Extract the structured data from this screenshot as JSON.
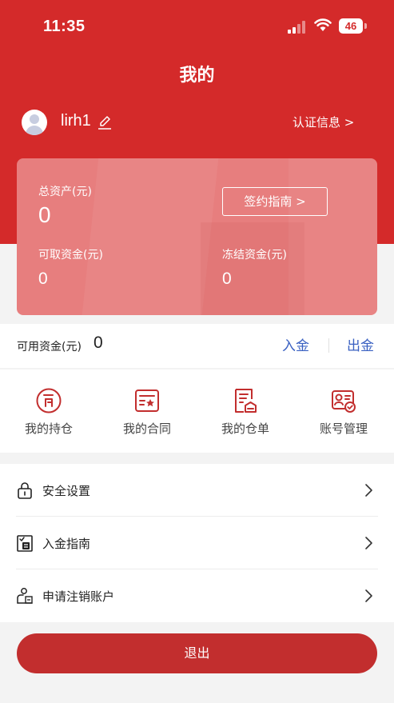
{
  "status_bar": {
    "time": "11:35",
    "battery": "46"
  },
  "header": {
    "title": "我的"
  },
  "profile": {
    "username": "lirh1",
    "cert_link": "认证信息 >"
  },
  "asset_card": {
    "total_assets_label": "总资产(元)",
    "total_assets_value": "0",
    "sign_guide_label": "签约指南 >",
    "withdrawable_label": "可取资金(元)",
    "withdrawable_value": "0",
    "frozen_label": "冻结资金(元)",
    "frozen_value": "0"
  },
  "available": {
    "label": "可用资金(元)",
    "value": "0",
    "deposit_label": "入金",
    "withdraw_label": "出金"
  },
  "quick_actions": [
    {
      "label": "我的持仓",
      "icon": "position-icon"
    },
    {
      "label": "我的合同",
      "icon": "contract-icon"
    },
    {
      "label": "我的仓单",
      "icon": "warehouse-receipt-icon"
    },
    {
      "label": "账号管理",
      "icon": "account-manage-icon"
    }
  ],
  "menu": [
    {
      "label": "安全设置",
      "icon": "lock-icon"
    },
    {
      "label": "入金指南",
      "icon": "deposit-guide-icon"
    },
    {
      "label": "申请注销账户",
      "icon": "cancel-account-icon"
    }
  ],
  "logout_label": "退出",
  "colors": {
    "primary_red": "#d42a2a",
    "card_red": "#e77e7e",
    "link_blue": "#3a61c2",
    "logout_red": "#c22e2e"
  }
}
